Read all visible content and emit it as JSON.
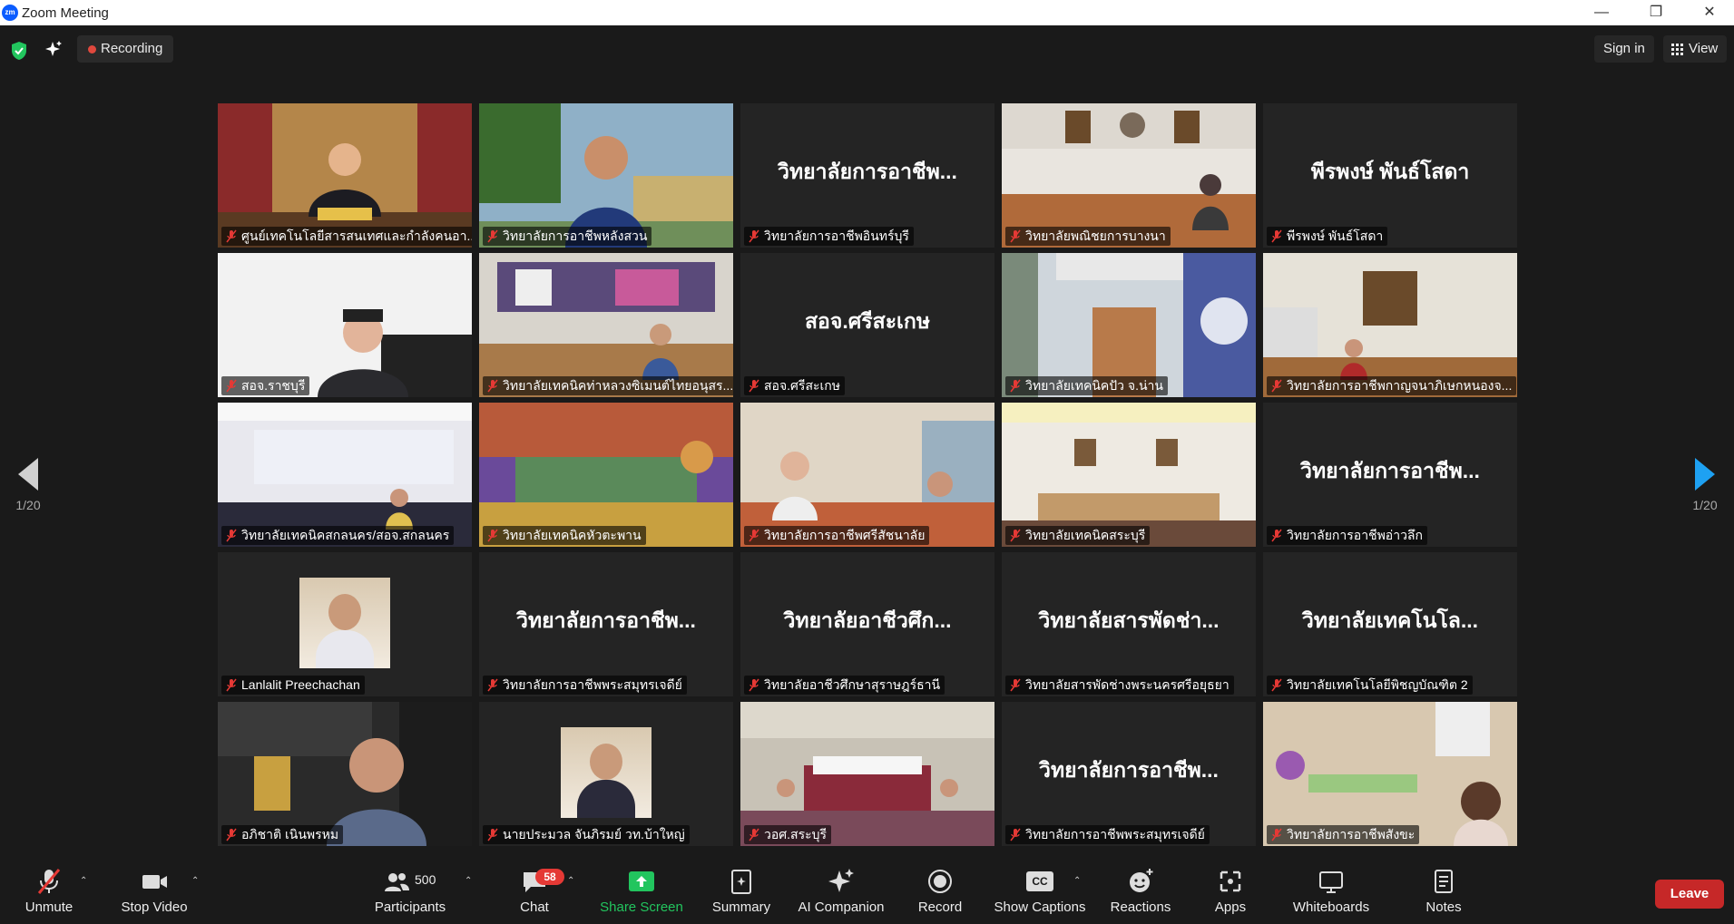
{
  "window": {
    "app_title": "Zoom Meeting",
    "logo_text": "zm"
  },
  "topbar": {
    "recording_label": "Recording",
    "signin_label": "Sign in",
    "view_label": "View"
  },
  "pager": {
    "left": "1/20",
    "right": "1/20"
  },
  "tiles": [
    {
      "name": "ศูนย์เทคโนโลยีสารสนเทศและกำลังคนอา...",
      "big": "",
      "video": true
    },
    {
      "name": "วิทยาลัยการอาชีพหลังสวน",
      "big": "",
      "video": true
    },
    {
      "name": "วิทยาลัยการอาชีพอินทร์บุรี",
      "big": "วิทยาลัยการอาชีพ...",
      "video": false
    },
    {
      "name": "วิทยาลัยพณิชยการบางนา",
      "big": "",
      "video": true
    },
    {
      "name": "พีรพงษ์ พันธ์โสดา",
      "big": "พีรพงษ์ พันธ์โสดา",
      "video": false
    },
    {
      "name": "สอจ.ราชบุรี",
      "big": "",
      "video": true
    },
    {
      "name": "วิทยาลัยเทคนิคท่าหลวงซิเมนต์ไทยอนุสร...",
      "big": "",
      "video": true
    },
    {
      "name": "สอจ.ศรีสะเกษ",
      "big": "สอจ.ศรีสะเกษ",
      "video": false
    },
    {
      "name": "วิทยาลัยเทคนิคปัว จ.น่าน",
      "big": "",
      "video": true
    },
    {
      "name": "วิทยาลัยการอาชีพกาญจนาภิเษกหนองจ...",
      "big": "",
      "video": true
    },
    {
      "name": "วิทยาลัยเทคนิคสกลนคร/สอจ.สกลนคร",
      "big": "",
      "video": true
    },
    {
      "name": "วิทยาลัยเทคนิคหัวตะพาน",
      "big": "",
      "video": true
    },
    {
      "name": "วิทยาลัยการอาชีพศรีสัชนาลัย",
      "big": "",
      "video": true
    },
    {
      "name": "วิทยาลัยเทคนิคสระบุรี",
      "big": "",
      "video": true
    },
    {
      "name": "วิทยาลัยการอาชีพอ่าวลึก",
      "big": "วิทยาลัยการอาชีพ...",
      "video": false
    },
    {
      "name": "Lanlalit Preechachan",
      "big": "",
      "video": false,
      "avatar": true
    },
    {
      "name": "วิทยาลัยการอาชีพพระสมุทรเจดีย์",
      "big": "วิทยาลัยการอาชีพ...",
      "video": false
    },
    {
      "name": "วิทยาลัยอาชีวศึกษาสุราษฎร์ธานี",
      "big": "วิทยาลัยอาชีวศึก...",
      "video": false
    },
    {
      "name": "วิทยาลัยสารพัดช่างพระนครศรีอยุธยา",
      "big": "วิทยาลัยสารพัดช่า...",
      "video": false
    },
    {
      "name": "วิทยาลัยเทคโนโลยีพิชญบัณฑิต 2",
      "big": "วิทยาลัยเทคโนโล...",
      "video": false
    },
    {
      "name": "อภิชาติ เนินพรหม",
      "big": "",
      "video": true
    },
    {
      "name": "นายประมวล จันภิรมย์ วท.บ้าใหญ่",
      "big": "",
      "video": false,
      "avatar": true
    },
    {
      "name": "วอศ.สระบุรี",
      "big": "",
      "video": true
    },
    {
      "name": "วิทยาลัยการอาชีพพระสมุทรเจดีย์",
      "big": "วิทยาลัยการอาชีพ...",
      "video": false
    },
    {
      "name": "วิทยาลัยการอาชีพสังขะ",
      "big": "",
      "video": true
    }
  ],
  "toolbar": {
    "unmute": "Unmute",
    "stop_video": "Stop Video",
    "participants": "Participants",
    "participants_count": "500",
    "chat": "Chat",
    "chat_badge": "58",
    "share": "Share Screen",
    "summary": "Summary",
    "ai": "AI Companion",
    "record": "Record",
    "cc": "Show Captions",
    "cc_icon": "CC",
    "reactions": "Reactions",
    "apps": "Apps",
    "whiteboards": "Whiteboards",
    "notes": "Notes",
    "leave": "Leave"
  },
  "colors": {
    "accent_green": "#22c55e",
    "leave_red": "#c62828",
    "active_border": "#dfe97a",
    "pager_blue": "#1ea1f2"
  }
}
